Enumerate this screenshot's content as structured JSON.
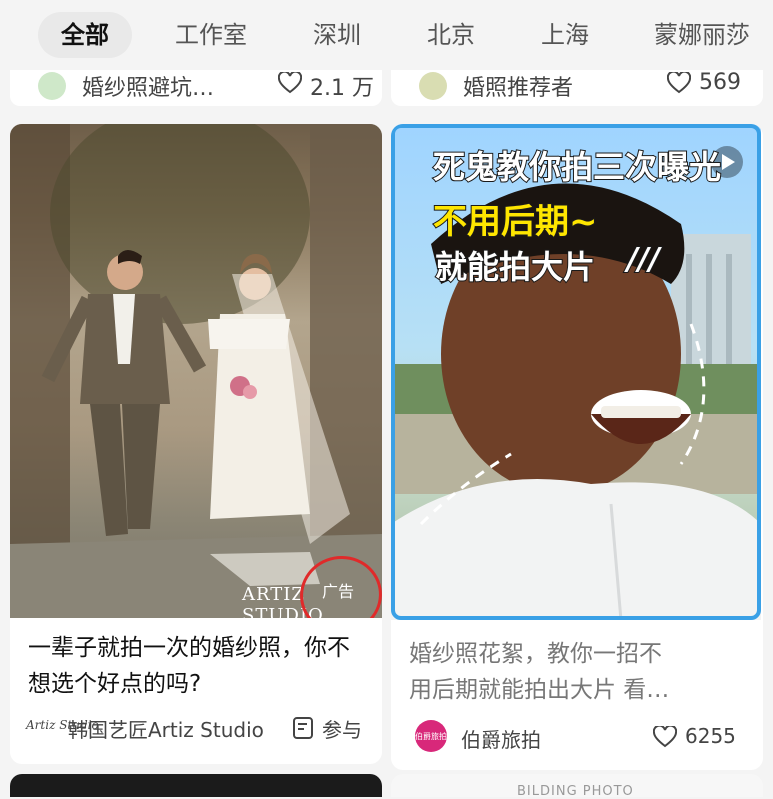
{
  "tabs": [
    "全部",
    "工作室",
    "深圳",
    "北京",
    "上海",
    "蒙娜丽莎"
  ],
  "prev_cards": [
    {
      "author": "婚纱照避坑…",
      "likes": "2.1 万"
    },
    {
      "author": "婚照推荐者",
      "likes": "569"
    }
  ],
  "cards": [
    {
      "image_text": {
        "brand": "ARTIZ STUDIO",
        "ad_label": "广告"
      },
      "title_line1": "一辈子就拍一次的婚纱照，你不",
      "title_line2": "想选个好点的吗?",
      "author": "韩国艺匠Artiz Studio",
      "author_logo": "Artiz Studio",
      "action": "参与"
    },
    {
      "image_text": {
        "line1": "死鬼教你拍三次曝光",
        "line2": "不用后期~",
        "line3": "就能拍大片",
        "slashes": "///"
      },
      "title_line1": "婚纱照花絮，教你一招不",
      "title_line2": "用后期就能拍出大片 看…",
      "author": "伯爵旅拍",
      "avatar_text": "伯爵旅拍",
      "likes": "6255"
    }
  ],
  "bottom_peek": {
    "right_text": "BILDING PHOTO"
  },
  "colors": {
    "accent_red": "#e02a2a",
    "video_border": "#3aa0e6",
    "avatar_pink": "#d8287a"
  }
}
